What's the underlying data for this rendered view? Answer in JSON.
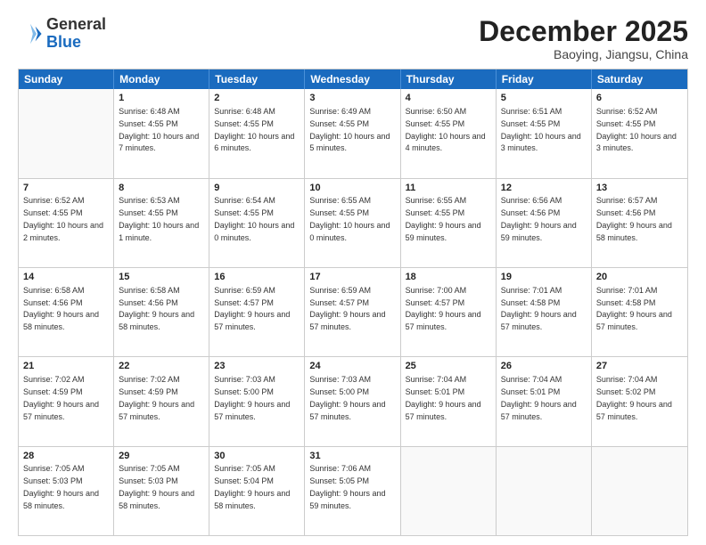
{
  "header": {
    "logo": {
      "line1": "General",
      "line2": "Blue"
    },
    "title": "December 2025",
    "location": "Baoying, Jiangsu, China"
  },
  "days_of_week": [
    "Sunday",
    "Monday",
    "Tuesday",
    "Wednesday",
    "Thursday",
    "Friday",
    "Saturday"
  ],
  "weeks": [
    [
      {
        "day": "",
        "empty": true
      },
      {
        "day": "1",
        "sunrise": "6:48 AM",
        "sunset": "4:55 PM",
        "daylight": "10 hours and 7 minutes."
      },
      {
        "day": "2",
        "sunrise": "6:48 AM",
        "sunset": "4:55 PM",
        "daylight": "10 hours and 6 minutes."
      },
      {
        "day": "3",
        "sunrise": "6:49 AM",
        "sunset": "4:55 PM",
        "daylight": "10 hours and 5 minutes."
      },
      {
        "day": "4",
        "sunrise": "6:50 AM",
        "sunset": "4:55 PM",
        "daylight": "10 hours and 4 minutes."
      },
      {
        "day": "5",
        "sunrise": "6:51 AM",
        "sunset": "4:55 PM",
        "daylight": "10 hours and 3 minutes."
      },
      {
        "day": "6",
        "sunrise": "6:52 AM",
        "sunset": "4:55 PM",
        "daylight": "10 hours and 3 minutes."
      }
    ],
    [
      {
        "day": "7",
        "sunrise": "6:52 AM",
        "sunset": "4:55 PM",
        "daylight": "10 hours and 2 minutes."
      },
      {
        "day": "8",
        "sunrise": "6:53 AM",
        "sunset": "4:55 PM",
        "daylight": "10 hours and 1 minute."
      },
      {
        "day": "9",
        "sunrise": "6:54 AM",
        "sunset": "4:55 PM",
        "daylight": "10 hours and 0 minutes."
      },
      {
        "day": "10",
        "sunrise": "6:55 AM",
        "sunset": "4:55 PM",
        "daylight": "10 hours and 0 minutes."
      },
      {
        "day": "11",
        "sunrise": "6:55 AM",
        "sunset": "4:55 PM",
        "daylight": "9 hours and 59 minutes."
      },
      {
        "day": "12",
        "sunrise": "6:56 AM",
        "sunset": "4:56 PM",
        "daylight": "9 hours and 59 minutes."
      },
      {
        "day": "13",
        "sunrise": "6:57 AM",
        "sunset": "4:56 PM",
        "daylight": "9 hours and 58 minutes."
      }
    ],
    [
      {
        "day": "14",
        "sunrise": "6:58 AM",
        "sunset": "4:56 PM",
        "daylight": "9 hours and 58 minutes."
      },
      {
        "day": "15",
        "sunrise": "6:58 AM",
        "sunset": "4:56 PM",
        "daylight": "9 hours and 58 minutes."
      },
      {
        "day": "16",
        "sunrise": "6:59 AM",
        "sunset": "4:57 PM",
        "daylight": "9 hours and 57 minutes."
      },
      {
        "day": "17",
        "sunrise": "6:59 AM",
        "sunset": "4:57 PM",
        "daylight": "9 hours and 57 minutes."
      },
      {
        "day": "18",
        "sunrise": "7:00 AM",
        "sunset": "4:57 PM",
        "daylight": "9 hours and 57 minutes."
      },
      {
        "day": "19",
        "sunrise": "7:01 AM",
        "sunset": "4:58 PM",
        "daylight": "9 hours and 57 minutes."
      },
      {
        "day": "20",
        "sunrise": "7:01 AM",
        "sunset": "4:58 PM",
        "daylight": "9 hours and 57 minutes."
      }
    ],
    [
      {
        "day": "21",
        "sunrise": "7:02 AM",
        "sunset": "4:59 PM",
        "daylight": "9 hours and 57 minutes."
      },
      {
        "day": "22",
        "sunrise": "7:02 AM",
        "sunset": "4:59 PM",
        "daylight": "9 hours and 57 minutes."
      },
      {
        "day": "23",
        "sunrise": "7:03 AM",
        "sunset": "5:00 PM",
        "daylight": "9 hours and 57 minutes."
      },
      {
        "day": "24",
        "sunrise": "7:03 AM",
        "sunset": "5:00 PM",
        "daylight": "9 hours and 57 minutes."
      },
      {
        "day": "25",
        "sunrise": "7:04 AM",
        "sunset": "5:01 PM",
        "daylight": "9 hours and 57 minutes."
      },
      {
        "day": "26",
        "sunrise": "7:04 AM",
        "sunset": "5:01 PM",
        "daylight": "9 hours and 57 minutes."
      },
      {
        "day": "27",
        "sunrise": "7:04 AM",
        "sunset": "5:02 PM",
        "daylight": "9 hours and 57 minutes."
      }
    ],
    [
      {
        "day": "28",
        "sunrise": "7:05 AM",
        "sunset": "5:03 PM",
        "daylight": "9 hours and 58 minutes."
      },
      {
        "day": "29",
        "sunrise": "7:05 AM",
        "sunset": "5:03 PM",
        "daylight": "9 hours and 58 minutes."
      },
      {
        "day": "30",
        "sunrise": "7:05 AM",
        "sunset": "5:04 PM",
        "daylight": "9 hours and 58 minutes."
      },
      {
        "day": "31",
        "sunrise": "7:06 AM",
        "sunset": "5:05 PM",
        "daylight": "9 hours and 59 minutes."
      },
      {
        "day": "",
        "empty": true
      },
      {
        "day": "",
        "empty": true
      },
      {
        "day": "",
        "empty": true
      }
    ]
  ]
}
